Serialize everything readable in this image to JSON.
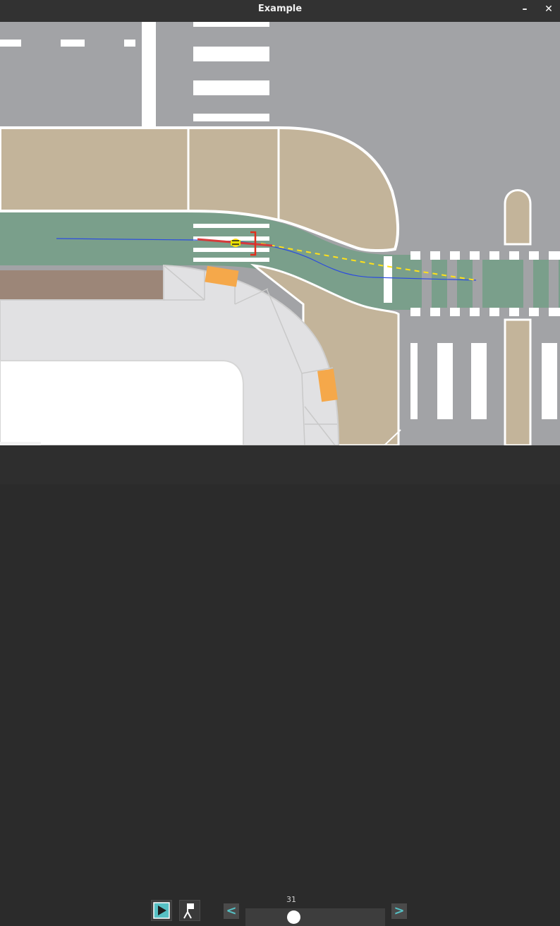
{
  "window": {
    "title": "Example",
    "minimize_label": "–",
    "close_label": "✕"
  },
  "toolbar": {
    "play_icon": "play-icon",
    "camera_icon": "camera-follow-icon",
    "prev_label": "<",
    "next_label": ">"
  },
  "timeline": {
    "frame": "31",
    "position_fraction": 0.33
  },
  "colors": {
    "road": "#a2a3a6",
    "sidewalk": "#c3b49a",
    "bike_lane": "#7a9f8b",
    "lane_marking": "#ffffff",
    "parking": "#f5a84a",
    "planned_path": "#ffe11a",
    "trajectory": "#2b4be0",
    "vehicle_box": "#e0301e",
    "accent": "#56c0c4"
  }
}
